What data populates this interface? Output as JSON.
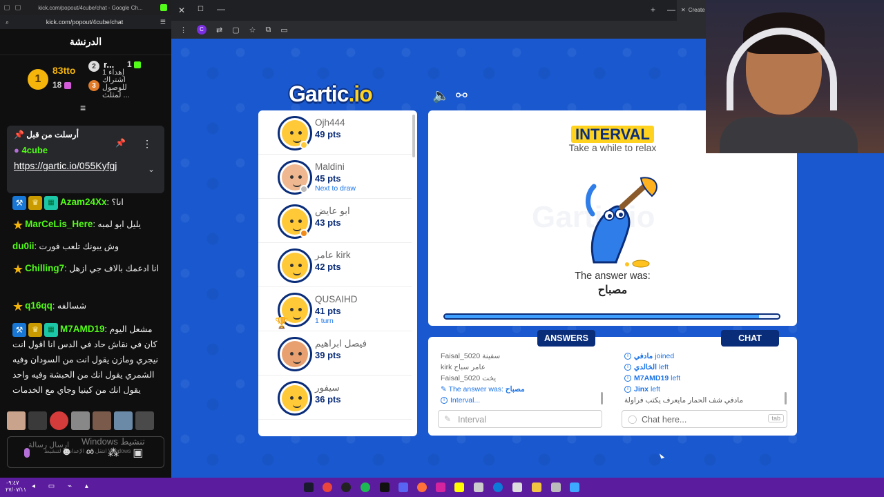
{
  "chat_window": {
    "tab_url": "kick.com/popout/4cube/chat - Google Ch...",
    "address": "kick.com/popout/4cube/chat",
    "title": "الدرنشة",
    "leaderboard": {
      "first_rank": "1",
      "first_name": "83tto",
      "first_count": "18",
      "second_rank": "2",
      "second_name": "r...",
      "second_count": "1",
      "third_rank": "3",
      "third_lines": [
        "إهداء 1",
        "اشتراك",
        "للوصول",
        "لمثلث ..."
      ]
    },
    "pinned": {
      "header": "أرسلت من قبل",
      "user": "4cube",
      "link": "https://gartic.io/055Kyfgj"
    },
    "messages": [
      {
        "user": "Azam24Xx",
        "user_color": "#53fc18",
        "text": "انا؟",
        "badges": [
          "tool",
          "crown",
          "sub"
        ]
      },
      {
        "user": "MarCeLis_Here",
        "user_color": "#53fc18",
        "text": "يليل ابو لمبه",
        "badges": [
          "star"
        ]
      },
      {
        "user": "du0ii",
        "user_color": "#53fc18",
        "text": "وش يبونك تلعب فورت",
        "badges": []
      },
      {
        "user": "Chilling7",
        "user_color": "#53fc18",
        "text": "انا ادعمك بالاف جي ازهل",
        "badges": [
          "star"
        ]
      },
      {
        "user": "q16qq",
        "user_color": "#53fc18",
        "text": "شسالفه",
        "badges": [
          "star"
        ]
      },
      {
        "user": "M7AMD19",
        "user_color": "#53fc18",
        "text": "مشعل اليوم كان في نقاش حاد في الدس انا اقول انت نيجري ومازن يقول انت من السودان وفيه الشمري يقول انك من الحبشة وفيه واحد يقول انك من كينيا وجاي مع الخدمات",
        "badges": [
          "tool",
          "crown",
          "sub"
        ]
      }
    ],
    "input_placeholder": "ارسال رسالة",
    "watermark": "Windows تنشيط",
    "watermark_sub": "انتقل إلى الإعدادات لتنشيط Windows"
  },
  "browser": {
    "create_tab": "Create R"
  },
  "game": {
    "logo_main": "Gartic",
    "logo_suffix": ".io",
    "players": [
      {
        "name": "Ojh444",
        "points": "49 pts",
        "sub": "",
        "status_color": "#ffc938"
      },
      {
        "name": "Maldini",
        "points": "45 pts",
        "sub": "Next to draw",
        "status_color": "#bbbbbb"
      },
      {
        "name": "ابو عايض",
        "points": "43 pts",
        "sub": "",
        "status_color": "#f08a1a"
      },
      {
        "name": "عامر kirk",
        "points": "42 pts",
        "sub": "",
        "status_color": ""
      },
      {
        "name": "QUSAIHD",
        "points": "41 pts",
        "sub": "1 turn",
        "status_color": ""
      },
      {
        "name": "فيصل ابراهيم",
        "points": "39 pts",
        "sub": "",
        "status_color": ""
      },
      {
        "name": "سيفور",
        "points": "36 pts",
        "sub": "",
        "status_color": ""
      }
    ],
    "stage": {
      "title": "INTERVAL",
      "subtitle": "Take a while to relax",
      "answer_label": "The answer was:",
      "answer_word": "مصباح",
      "progress": 0.94
    },
    "answers_tab": "ANSWERS",
    "chat_tab": "CHAT",
    "answers": [
      {
        "user": "Faisal_5020",
        "text": "سفينة"
      },
      {
        "user": "kirk عامر",
        "text": "سباح"
      },
      {
        "user": "Faisal_5020",
        "text": "يخت"
      }
    ],
    "answer_reveal_label": "The answer was:",
    "answer_reveal_word": "مصباح",
    "interval_line": "Interval...",
    "answer_input_placeholder": "Interval",
    "chat_lines": [
      {
        "user": "مادفي",
        "action": "joined"
      },
      {
        "user": "الخالدي",
        "action": "left"
      },
      {
        "user": "M7AMD19",
        "action": "left"
      },
      {
        "user": "Jinx",
        "action": "left"
      }
    ],
    "chat_last_line": "مادفي شف الحمار مايعرف يكتب فراولة",
    "chat_input_placeholder": "Chat here...",
    "chat_tab_key": "tab"
  },
  "taskbar": {
    "time": "٠٩:٤٧",
    "date": "٢٧/٠٧/١١"
  }
}
